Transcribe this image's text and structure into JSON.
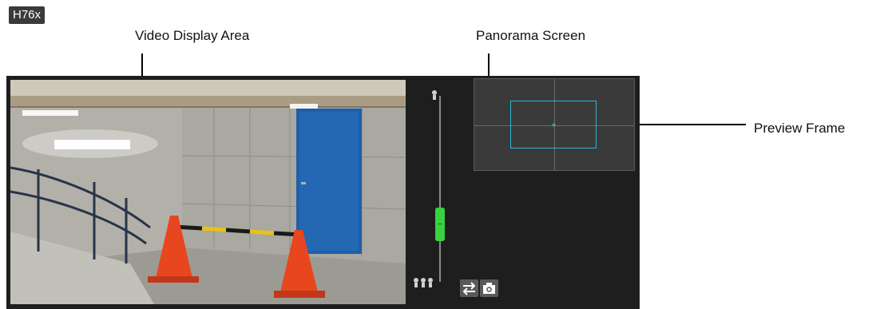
{
  "model_badge": "H76x",
  "callouts": {
    "video_display_area": "Video Display Area",
    "panorama_screen": "Panorama Screen",
    "preview_frame": "Preview Frame"
  },
  "zoom_slider": {
    "level": 0.6
  },
  "icons": {
    "zoom_tele": "single-figure-icon",
    "zoom_wide": "three-figures-icon",
    "switch": "swap-arrows-icon",
    "snapshot": "camera-icon"
  },
  "colors": {
    "panel_bg": "#1e1e1e",
    "slider_thumb": "#37d23f",
    "preview_frame": "#27b8d4",
    "cone": "#e8461f",
    "door": "#1f5fa8"
  }
}
